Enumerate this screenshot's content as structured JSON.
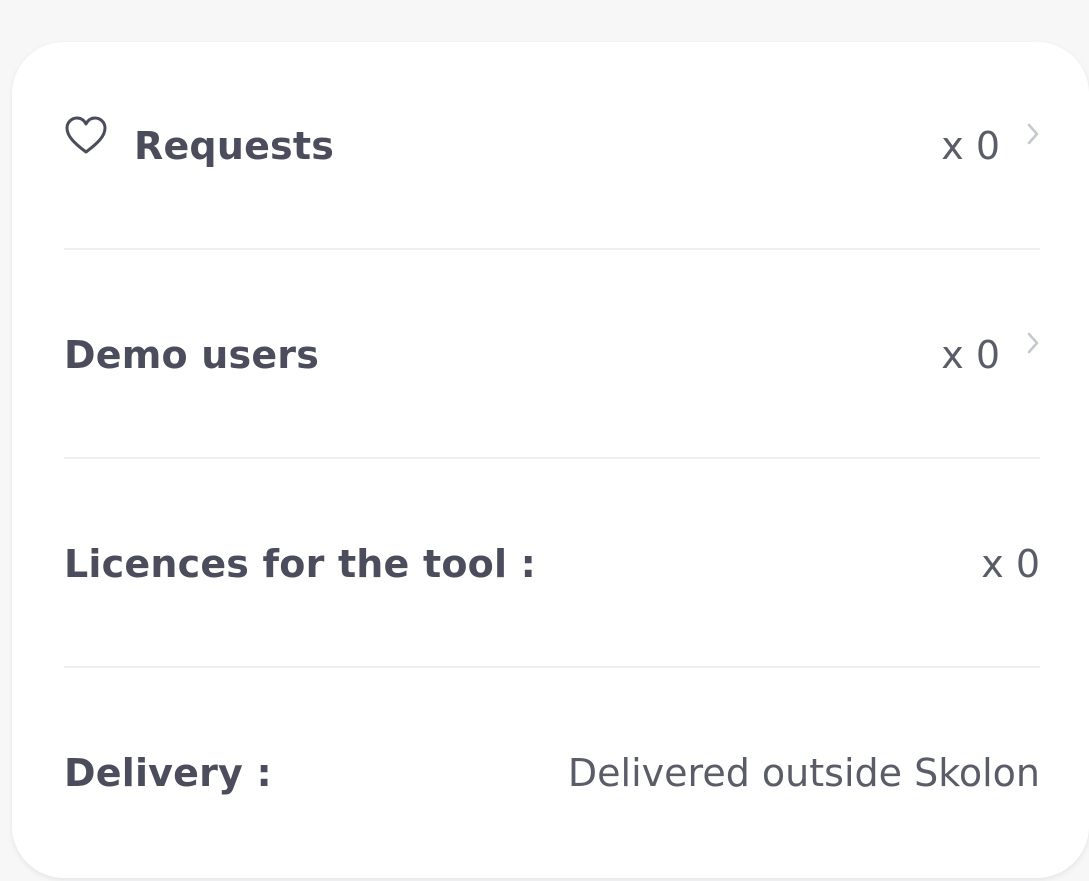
{
  "card": {
    "rows": [
      {
        "label": "Requests",
        "value": "x 0",
        "icon": "heart-outline-icon",
        "has_chevron": true
      },
      {
        "label": "Demo users",
        "value": "x 0",
        "has_chevron": true
      },
      {
        "label": "Licences for the tool :",
        "value": "x 0",
        "has_chevron": false
      },
      {
        "label": "Delivery :",
        "value": "Delivered outside Skolon",
        "has_chevron": false
      }
    ]
  },
  "colors": {
    "text": "#4b4d5c",
    "value_text": "#5a5c68",
    "chevron": "#c5c7cf",
    "divider": "#eeeff1",
    "card_bg": "#ffffff",
    "page_bg": "#f7f7f8"
  }
}
